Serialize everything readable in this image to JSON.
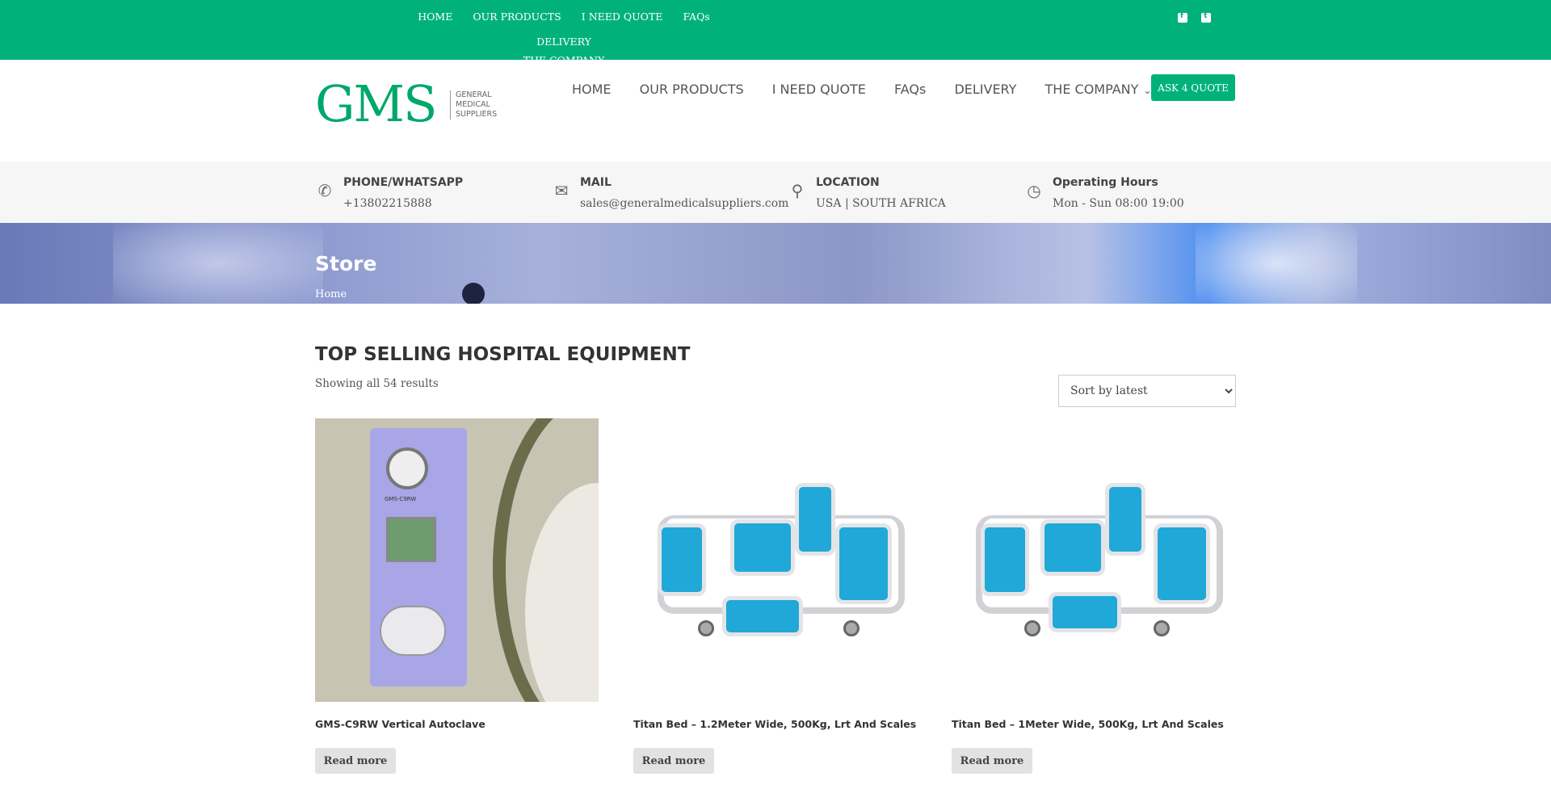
{
  "topbar": {
    "nav": [
      "HOME",
      "OUR PRODUCTS",
      "I NEED QUOTE",
      "FAQs",
      "DELIVERY",
      "THE COMPANY"
    ],
    "social": [
      "facebook-icon",
      "twitter-icon"
    ]
  },
  "header": {
    "logo_text": "GMS",
    "logo_sub": [
      "GENERAL",
      "MEDICAL",
      "SUPPLIERS"
    ],
    "nav": [
      "HOME",
      "OUR PRODUCTS",
      "I NEED QUOTE",
      "FAQs",
      "DELIVERY",
      "THE COMPANY"
    ],
    "quote_button": "ASK 4 QUOTE"
  },
  "info": [
    {
      "title": "PHONE/WHATSAPP",
      "value": "+13802215888",
      "icon": "phone-icon"
    },
    {
      "title": "MAIL",
      "value": "sales@generalmedicalsuppliers.com",
      "icon": "mail-icon"
    },
    {
      "title": "LOCATION",
      "value": "USA | SOUTH AFRICA",
      "icon": "map-pin-icon"
    },
    {
      "title": "Operating Hours",
      "value": "Mon - Sun 08:00 19:00",
      "icon": "clock-icon"
    }
  ],
  "hero": {
    "title": "Store",
    "breadcrumb": "Home"
  },
  "shop": {
    "title": "TOP SELLING HOSPITAL EQUIPMENT",
    "count": "Showing all 54 results",
    "sort_selected": "Sort by latest"
  },
  "products": [
    {
      "name": "GMS-C9RW Vertical Autoclave",
      "button": "Read more",
      "panel_label": "GMS-C9RW"
    },
    {
      "name": "Titan Bed – 1.2Meter Wide, 500Kg, Lrt And Scales",
      "button": "Read more"
    },
    {
      "name": "Titan Bed – 1Meter Wide, 500Kg, Lrt And Scales",
      "button": "Read more"
    }
  ],
  "colors": {
    "brand_green": "#00b27a",
    "bed_blue": "#20a8d8"
  }
}
